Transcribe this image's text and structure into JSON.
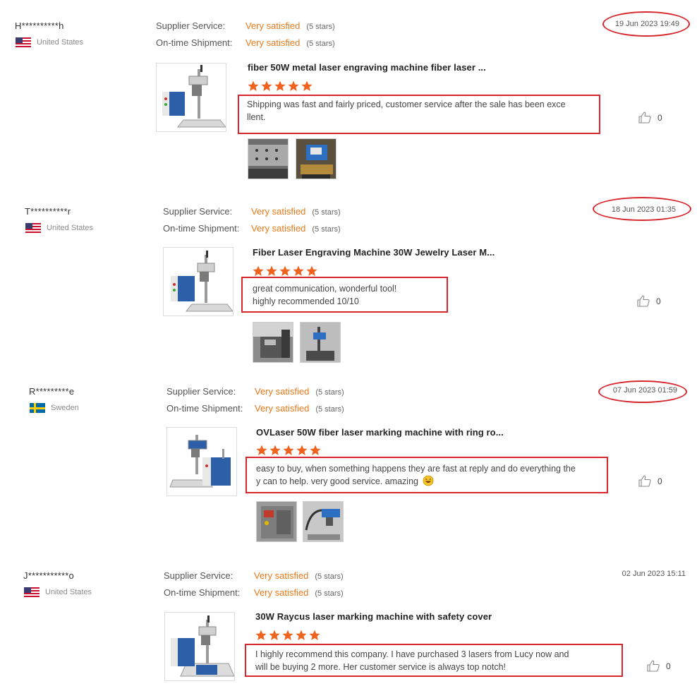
{
  "labels": {
    "supplier_service": "Supplier Service:",
    "ontime_shipment": "On-time Shipment:"
  },
  "colors": {
    "accent_orange": "#e8791b",
    "annotation_red": "#d7262c"
  },
  "reviews": [
    {
      "user": "H**********h",
      "country": "United States",
      "flag_icon": "us-flag-icon",
      "supplier_value": "Very satisfied",
      "supplier_stars": "(5 stars)",
      "shipment_value": "Very satisfied",
      "shipment_stars": "(5 stars)",
      "date": "19 Jun 2023 19:49",
      "product_title": "fiber 50W metal laser engraving machine fiber laser ...",
      "rating": 5,
      "text_lines": [
        "Shipping was fast and fairly priced, customer service after the sale has been exce",
        "llent."
      ],
      "likes": "0"
    },
    {
      "user": "T**********r",
      "country": "United States",
      "flag_icon": "us-flag-icon",
      "supplier_value": "Very satisfied",
      "supplier_stars": "(5 stars)",
      "shipment_value": "Very satisfied",
      "shipment_stars": "(5 stars)",
      "date": "18 Jun 2023 01:35",
      "product_title": "Fiber Laser Engraving Machine 30W Jewelry Laser M...",
      "rating": 5,
      "text_lines": [
        "great communication, wonderful tool!",
        "highly recommended 10/10"
      ],
      "likes": "0"
    },
    {
      "user": "R*********e",
      "country": "Sweden",
      "flag_icon": "sweden-flag-icon",
      "supplier_value": "Very satisfied",
      "supplier_stars": "(5 stars)",
      "shipment_value": "Very satisfied",
      "shipment_stars": "(5 stars)",
      "date": "07 Jun 2023 01:59",
      "product_title": "OVLaser 50W fiber laser marking machine with ring ro...",
      "rating": 5,
      "text_lines": [
        "easy to buy, when something happens they are fast at reply and do everything the",
        "y can to help. very good service. amazing"
      ],
      "emoji_icon": "grinning-sweat-emoji-icon",
      "likes": "0"
    },
    {
      "user": "J***********o",
      "country": "United States",
      "flag_icon": "us-flag-icon",
      "supplier_value": "Very satisfied",
      "supplier_stars": "(5 stars)",
      "shipment_value": "Very satisfied",
      "shipment_stars": "(5 stars)",
      "date": "02 Jun 2023 15:11",
      "product_title": "30W Raycus laser marking machine with safety cover",
      "rating": 5,
      "text_lines": [
        "I highly recommend this company.  I have purchased 3 lasers from Lucy now and",
        "will be buying 2 more.  Her customer service is always top notch!"
      ],
      "likes": "0"
    }
  ]
}
